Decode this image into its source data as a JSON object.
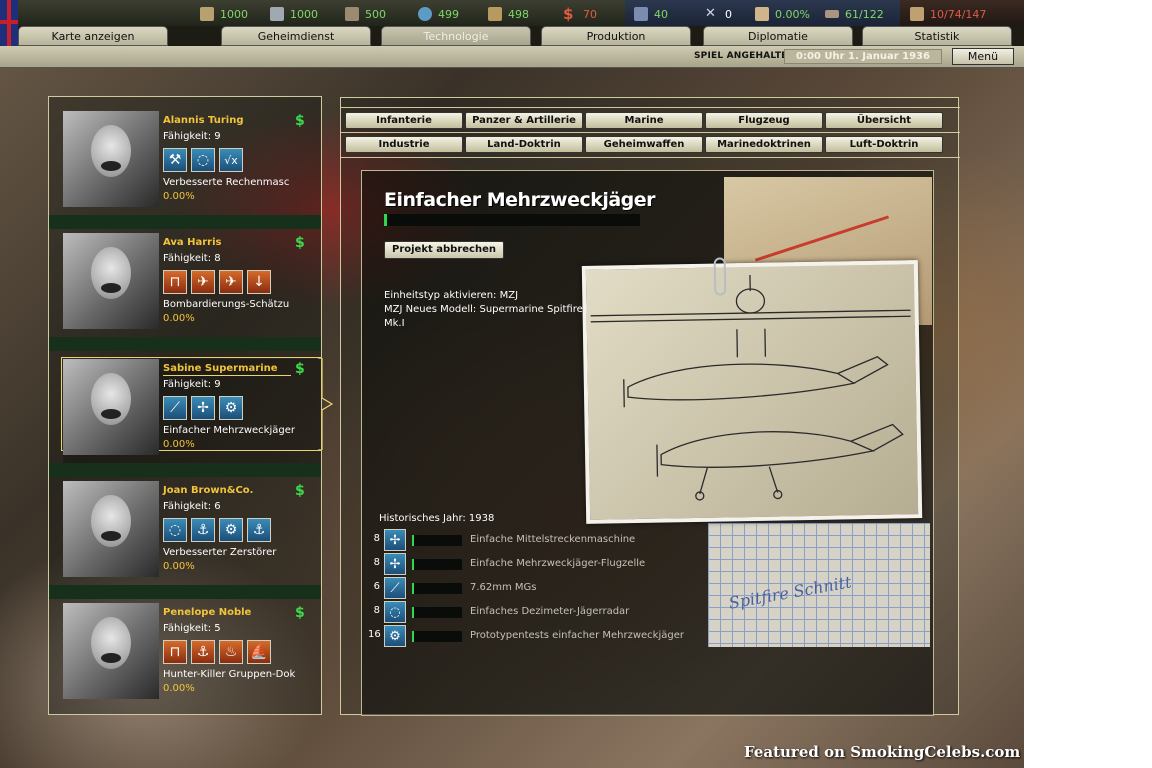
{
  "resources": [
    {
      "icon": "energy-icon",
      "value": "1000",
      "color": "#7fd76a"
    },
    {
      "icon": "metal-icon",
      "value": "1000",
      "color": "#7fd76a"
    },
    {
      "icon": "rare-materials-icon",
      "value": "500",
      "color": "#7fd76a"
    },
    {
      "icon": "oil-icon",
      "value": "499",
      "color": "#7fd76a"
    },
    {
      "icon": "supplies-icon",
      "value": "498",
      "color": "#7fd76a"
    },
    {
      "icon": "money-icon",
      "value": "70",
      "color": "#e25a44"
    },
    {
      "icon": "manpower-icon",
      "value": "40",
      "color": "#7fd76a"
    },
    {
      "icon": "transports-icon",
      "value": "0",
      "color": "#ffffff"
    },
    {
      "icon": "dissent-icon",
      "value": "0.00%",
      "color": "#7fd76a"
    },
    {
      "icon": "convoy-icon",
      "value": "61/122",
      "color": "#7fd76a"
    },
    {
      "icon": "divisions-icon",
      "value": "10/74/147",
      "color": "#e25a44"
    }
  ],
  "tabs": [
    {
      "label": "Karte anzeigen",
      "active": false
    },
    {
      "label": "Geheimdienst",
      "active": false
    },
    {
      "label": "Technologie",
      "active": true
    },
    {
      "label": "Produktion",
      "active": false
    },
    {
      "label": "Diplomatie",
      "active": false
    },
    {
      "label": "Statistik",
      "active": false
    }
  ],
  "status": {
    "paused": "SPIEL ANGEHALTEN",
    "date": "0:00 Uhr 1. Januar 1936",
    "menu": "Menü"
  },
  "scientists": [
    {
      "name": "Alannis Turing",
      "skill": "Fähigkeit: 9",
      "project": "Verbesserte Rechenmasc",
      "progress": "0.00%",
      "icons": [
        "wrench-icon",
        "lightbulb-icon",
        "math-root-icon"
      ],
      "icon_color": "blue",
      "selected": false
    },
    {
      "name": "Ava Harris",
      "skill": "Fähigkeit: 8",
      "project": "Bombardierungs-Schätzu",
      "progress": "0.00%",
      "icons": [
        "barracks-icon",
        "plane-icon",
        "bomber-icon",
        "bomb-icon"
      ],
      "icon_color": "orange",
      "selected": false
    },
    {
      "name": "Sabine Supermarine",
      "skill": "Fähigkeit: 9",
      "project": "Einfacher Mehrzweckjäger",
      "progress": "0.00%",
      "icons": [
        "gun-icon",
        "propeller-icon",
        "gears-icon"
      ],
      "icon_color": "blue",
      "selected": true
    },
    {
      "name": "Joan Brown&Co.",
      "skill": "Fähigkeit: 6",
      "project": "Verbesserter Zerstörer",
      "progress": "0.00%",
      "icons": [
        "lightbulb-icon",
        "anchor-icon",
        "gears-icon",
        "naval-gun-icon"
      ],
      "icon_color": "blue",
      "selected": false
    },
    {
      "name": "Penelope Noble",
      "skill": "Fähigkeit: 5",
      "project": "Hunter-Killer Gruppen-Dok",
      "progress": "0.00%",
      "icons": [
        "barracks-icon",
        "naval-icon",
        "fire-icon",
        "ship-icon"
      ],
      "icon_color": "orange",
      "selected": false
    }
  ],
  "categories_row1": [
    "Infanterie",
    "Panzer & Artillerie",
    "Marine",
    "Flugzeug",
    "Übersicht"
  ],
  "categories_row2": [
    "Industrie",
    "Land-Doktrin",
    "Geheimwaffen",
    "Marinedoktrinen",
    "Luft-Doktrin"
  ],
  "project": {
    "title": "Einfacher Mehrzweckjäger",
    "progress": 0.01,
    "cancel": "Projekt abbrechen",
    "effect1": "Einheitstyp aktivieren: MZJ",
    "effect2": "MZJ Neues Modell: Supermarine Spitfire Mk.I",
    "historical_year": "Historisches Jahr: 1938",
    "graph_note": "Spitfire Schnitt",
    "requirements": [
      {
        "num": "8",
        "icon": "propeller-icon",
        "label": "Einfache Mittelstreckenmaschine",
        "progress": 0.0
      },
      {
        "num": "8",
        "icon": "propeller-icon",
        "label": "Einfache Mehrzweckjäger-Flugzelle",
        "progress": 0.0
      },
      {
        "num": "6",
        "icon": "gun-icon",
        "label": "7.62mm MGs",
        "progress": 0.0
      },
      {
        "num": "8",
        "icon": "lightbulb-icon",
        "label": "Einfaches Dezimeter-Jägerradar",
        "progress": 0.0
      },
      {
        "num": "16",
        "icon": "gears-icon",
        "label": "Prototypentests einfacher Mehrzweckjäger",
        "progress": 0.0
      }
    ]
  },
  "watermark": "Featured on SmokingCelebs.com"
}
